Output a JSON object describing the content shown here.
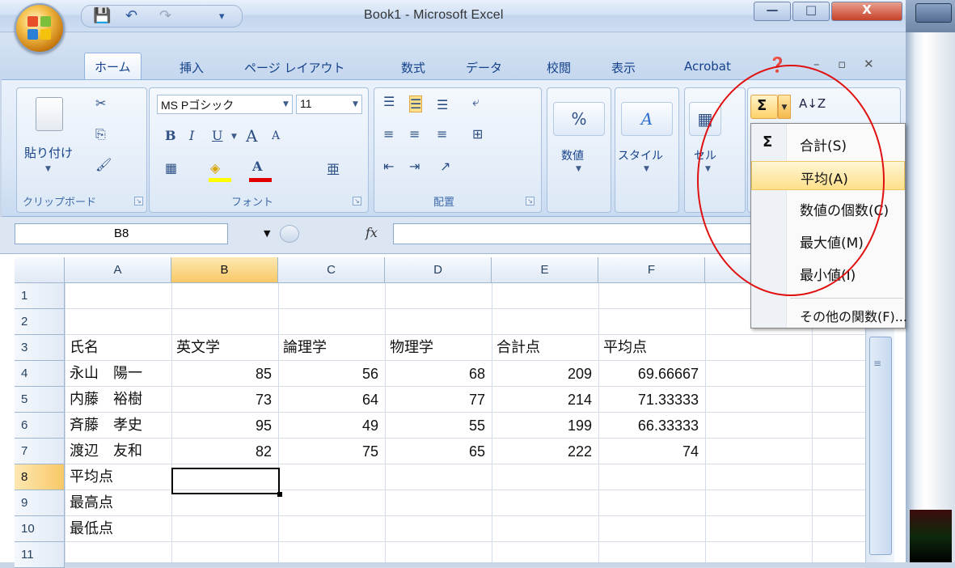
{
  "window": {
    "title": "Book1 - Microsoft Excel",
    "min_label": "—",
    "max_label": "□",
    "close_label": "X"
  },
  "quick_access": {
    "save": "💾",
    "undo": "↶",
    "redo": "↷",
    "customize": "▾"
  },
  "tabs": [
    "ホーム",
    "挿入",
    "ページ レイアウト",
    "数式",
    "データ",
    "校閲",
    "表示",
    "Acrobat"
  ],
  "ribbon": {
    "clipboard": {
      "paste_label": "貼り付け",
      "group_label": "クリップボード"
    },
    "font": {
      "name": "MS Pゴシック",
      "size": "11",
      "group_label": "フォント",
      "bold": "B",
      "italic": "I",
      "underline": "U",
      "grow": "A",
      "shrink": "A"
    },
    "alignment": {
      "group_label": "配置"
    },
    "number": {
      "label": "数値",
      "percent": "%"
    },
    "style": {
      "label": "スタイル"
    },
    "cells": {
      "label": "セル"
    }
  },
  "formula_bar": {
    "name_box": "B8",
    "fx": "fx",
    "formula": ""
  },
  "columns": [
    "A",
    "B",
    "C",
    "D",
    "E",
    "F"
  ],
  "rows": [
    {
      "num": "1",
      "cells": [
        "",
        "",
        "",
        "",
        "",
        ""
      ]
    },
    {
      "num": "2",
      "cells": [
        "",
        "",
        "",
        "",
        "",
        ""
      ]
    },
    {
      "num": "3",
      "cells": [
        "氏名",
        "英文学",
        "論理学",
        "物理学",
        "合計点",
        "平均点"
      ]
    },
    {
      "num": "4",
      "cells": [
        "永山　陽一",
        "85",
        "56",
        "68",
        "209",
        "69.66667"
      ]
    },
    {
      "num": "5",
      "cells": [
        "内藤　裕樹",
        "73",
        "64",
        "77",
        "214",
        "71.33333"
      ]
    },
    {
      "num": "6",
      "cells": [
        "斉藤　孝史",
        "95",
        "49",
        "55",
        "199",
        "66.33333"
      ]
    },
    {
      "num": "7",
      "cells": [
        "渡辺　友和",
        "82",
        "75",
        "65",
        "222",
        "74"
      ]
    },
    {
      "num": "8",
      "cells": [
        "平均点",
        "",
        "",
        "",
        "",
        ""
      ]
    },
    {
      "num": "9",
      "cells": [
        "最高点",
        "",
        "",
        "",
        "",
        ""
      ]
    },
    {
      "num": "10",
      "cells": [
        "最低点",
        "",
        "",
        "",
        "",
        ""
      ]
    },
    {
      "num": "11",
      "cells": [
        "",
        "",
        "",
        "",
        "",
        ""
      ]
    }
  ],
  "autosum": {
    "button": "Σ",
    "sort": "A↓Z",
    "menu": [
      {
        "label": "合計(S)",
        "icon": "Σ"
      },
      {
        "label": "平均(A)",
        "highlighted": true
      },
      {
        "label": "数値の個数(C)"
      },
      {
        "label": "最大値(M)"
      },
      {
        "label": "最小値(I)"
      },
      {
        "label": "その他の関数(F)..."
      }
    ]
  },
  "colors": {
    "accent": "#15428b",
    "selected_header": "#f8c866",
    "annotation": "#e01010"
  }
}
